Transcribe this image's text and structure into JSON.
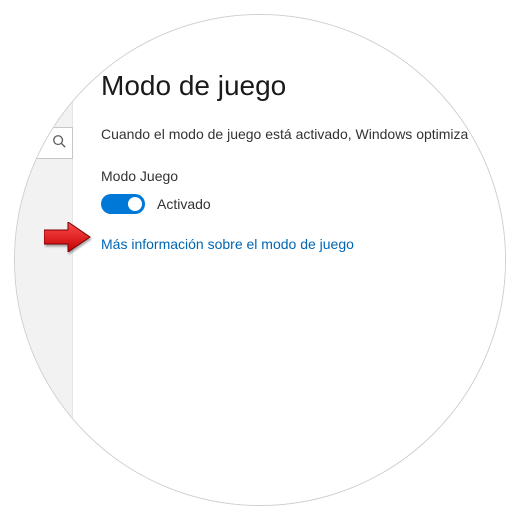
{
  "page": {
    "title": "Modo de juego",
    "description": "Cuando el modo de juego está activado, Windows optimiza el para jugar."
  },
  "setting": {
    "label": "Modo Juego",
    "status": "Activado"
  },
  "link": {
    "more_info": "Más información sobre el modo de juego"
  },
  "colors": {
    "accent": "#0078D7",
    "link": "#0066B4"
  }
}
